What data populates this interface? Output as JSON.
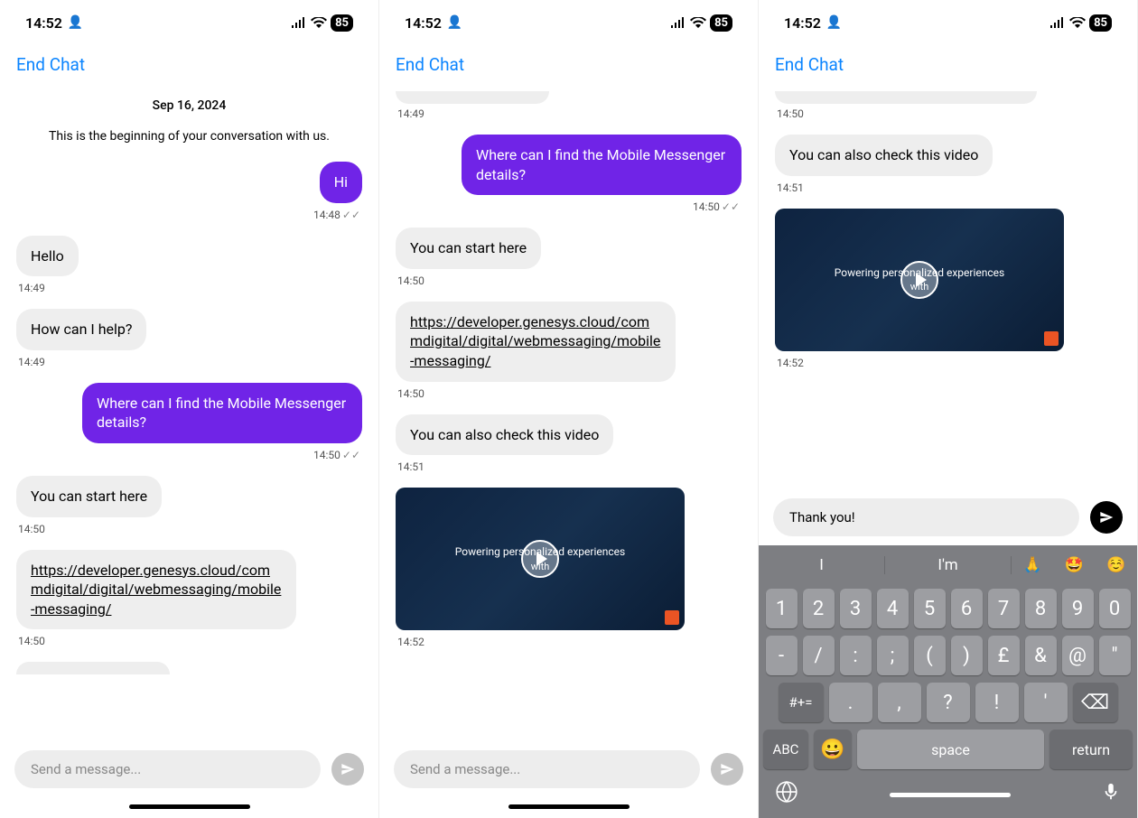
{
  "status_bar": {
    "time": "14:52",
    "battery": "85"
  },
  "header": {
    "end_chat": "End Chat"
  },
  "screen1": {
    "date": "Sep 16, 2024",
    "intro": "This is the beginning of your conversation with us.",
    "messages": [
      {
        "dir": "out",
        "text": "Hi",
        "time": "14:48",
        "read": true
      },
      {
        "dir": "in",
        "text": "Hello",
        "time": "14:49"
      },
      {
        "dir": "in",
        "text": "How can I help?",
        "time": "14:49"
      },
      {
        "dir": "out",
        "text": "Where can I find the Mobile Messenger details?",
        "time": "14:50",
        "read": true
      },
      {
        "dir": "in",
        "text": "You can start here",
        "time": "14:50"
      },
      {
        "dir": "in",
        "link": "https://developer.genesys.cloud/commdigital/digital/webmessaging/mobile-messaging/",
        "time": "14:50"
      }
    ],
    "input_placeholder": "Send a message..."
  },
  "screen2": {
    "partial_time_top": "14:49",
    "messages": [
      {
        "dir": "out",
        "text": "Where can I find the Mobile Messenger details?",
        "time": "14:50",
        "read": true
      },
      {
        "dir": "in",
        "text": "You can start here",
        "time": "14:50"
      },
      {
        "dir": "in",
        "link": "https://developer.genesys.cloud/commdigital/digital/webmessaging/mobile-messaging/",
        "time": "14:50"
      },
      {
        "dir": "in",
        "text": "You can also check this video",
        "time": "14:51"
      },
      {
        "dir": "in",
        "video": true,
        "time": "14:52"
      }
    ],
    "video_caption_l1": "Powering personalized experiences",
    "video_caption_l2": "with",
    "input_placeholder": "Send a message..."
  },
  "screen3": {
    "partial_time_top": "14:50",
    "messages": [
      {
        "dir": "in",
        "text": "You can also check this video",
        "time": "14:51"
      },
      {
        "dir": "in",
        "video": true,
        "time": "14:52"
      }
    ],
    "video_caption_l1": "Powering personalized experiences",
    "video_caption_l2": "with",
    "input_value": "Thank you!"
  },
  "keyboard": {
    "suggestions": [
      "I",
      "I'm"
    ],
    "emoji_suggestions": [
      "🙏",
      "🤩",
      "☺️"
    ],
    "row1": [
      "1",
      "2",
      "3",
      "4",
      "5",
      "6",
      "7",
      "8",
      "9",
      "0"
    ],
    "row2": [
      "-",
      "/",
      ":",
      ";",
      "(",
      ")",
      "£",
      "&",
      "@",
      "\""
    ],
    "row3_special": "#+=",
    "row3": [
      ".",
      ",",
      "?",
      "!",
      "'"
    ],
    "row3_backspace": "⌫",
    "bottom": {
      "abc": "ABC",
      "emoji": "😀",
      "space": "space",
      "return": "return"
    },
    "globe": "🌐",
    "mic": "🎤"
  }
}
